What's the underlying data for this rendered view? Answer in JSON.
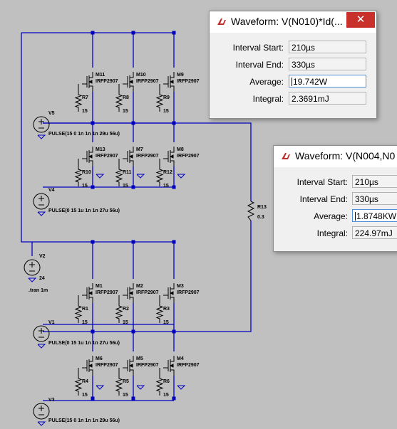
{
  "schematic": {
    "mosfets": [
      {
        "name": "M11",
        "model": "IRFP2907"
      },
      {
        "name": "M10",
        "model": "IRFP2907"
      },
      {
        "name": "M9",
        "model": "IRFP2907"
      },
      {
        "name": "M13",
        "model": "IRFP2907"
      },
      {
        "name": "M7",
        "model": "IRFP2907"
      },
      {
        "name": "M8",
        "model": "IRFP2907"
      },
      {
        "name": "M1",
        "model": "IRFP2907"
      },
      {
        "name": "M2",
        "model": "IRFP2907"
      },
      {
        "name": "M3",
        "model": "IRFP2907"
      },
      {
        "name": "M6",
        "model": "IRFP2907"
      },
      {
        "name": "M5",
        "model": "IRFP2907"
      },
      {
        "name": "M4",
        "model": "IRFP2907"
      }
    ],
    "resistors": [
      {
        "name": "R7",
        "value": "15"
      },
      {
        "name": "R8",
        "value": "15"
      },
      {
        "name": "R9",
        "value": "15"
      },
      {
        "name": "R10",
        "value": "15"
      },
      {
        "name": "R11",
        "value": "15"
      },
      {
        "name": "R12",
        "value": "15"
      },
      {
        "name": "R1",
        "value": "15"
      },
      {
        "name": "R2",
        "value": "15"
      },
      {
        "name": "R3",
        "value": "15"
      },
      {
        "name": "R4",
        "value": "15"
      },
      {
        "name": "R5",
        "value": "15"
      },
      {
        "name": "R6",
        "value": "15"
      },
      {
        "name": "R13",
        "value": "0.3"
      }
    ],
    "sources": [
      {
        "name": "V5",
        "value": "PULSE(15 0 1n 1n 1n 29u 56u)"
      },
      {
        "name": "V4",
        "value": "PULSE(0 15 1u 1n 1n 27u 56u)"
      },
      {
        "name": "V2",
        "value": "24"
      },
      {
        "name": "V1",
        "value": "PULSE(0 15 1u 1n 1n 27u 56u)"
      },
      {
        "name": "V3",
        "value": "PULSE(15 0 1n 1n 1n 29u 56u)"
      }
    ],
    "directive": ".tran 1m"
  },
  "windows": [
    {
      "title": "Waveform: V(N010)*Id(...",
      "close_glyph": "✕",
      "rows": [
        {
          "label": "Interval Start:",
          "value": "210µs"
        },
        {
          "label": "Interval End:",
          "value": "330µs"
        },
        {
          "label": "Average:",
          "value": "19.742W"
        },
        {
          "label": "Integral:",
          "value": "2.3691mJ"
        }
      ]
    },
    {
      "title": "Waveform: V(N004,N0",
      "rows": [
        {
          "label": "Interval Start:",
          "value": "210µs"
        },
        {
          "label": "Interval End:",
          "value": "330µs"
        },
        {
          "label": "Average:",
          "value": "1.8748KW"
        },
        {
          "label": "Integral:",
          "value": "224.97mJ"
        }
      ]
    }
  ],
  "colors": {
    "wire": "#0000c0",
    "ground": "#0000c0",
    "background": "#c0c0c0",
    "close_button": "#c7302b"
  }
}
